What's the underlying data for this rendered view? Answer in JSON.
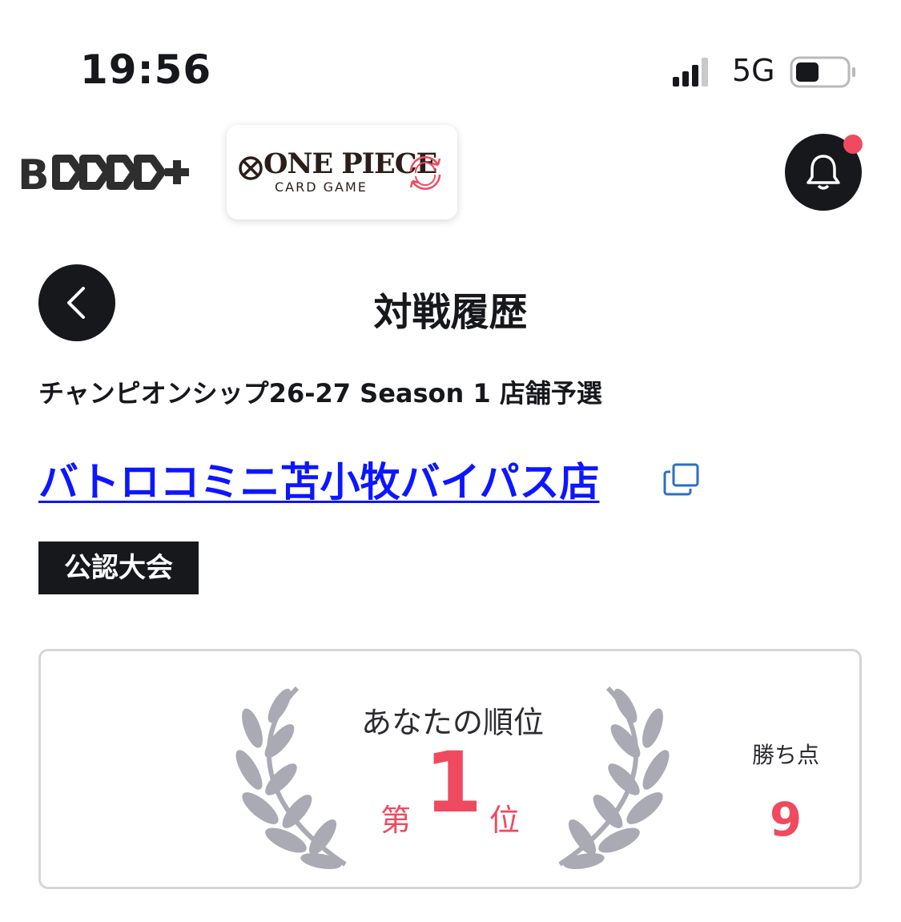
{
  "status_bar": {
    "time": "19:56",
    "network": "5G",
    "signal_icon": "cellular-signal-icon",
    "battery_icon": "battery-icon"
  },
  "header": {
    "brand_logo_text": "B TCG+",
    "game_title": "ONE PIECE",
    "game_subtitle": "CARD GAME",
    "notification_icon": "bell-icon",
    "has_unread": true
  },
  "page": {
    "back_icon": "chevron-left-icon",
    "title": "対戦履歴",
    "event_name": "チャンピオンシップ26-27 Season 1 店舗予選",
    "store_name": "バトロコミニ苫小牧バイパス店",
    "external_link_icon": "external-link-icon",
    "tag": "公認大会"
  },
  "result": {
    "rank_label": "あなたの順位",
    "rank_prefix": "第",
    "rank_value": "1",
    "rank_suffix": "位",
    "points_label": "勝ち点",
    "points_value": "9",
    "laurel_icon": "laurel-wreath-icon"
  },
  "colors": {
    "accent": "#ef4a60",
    "dark": "#17181c",
    "link": "#0d16ff",
    "laurel": "#a9aab3"
  }
}
